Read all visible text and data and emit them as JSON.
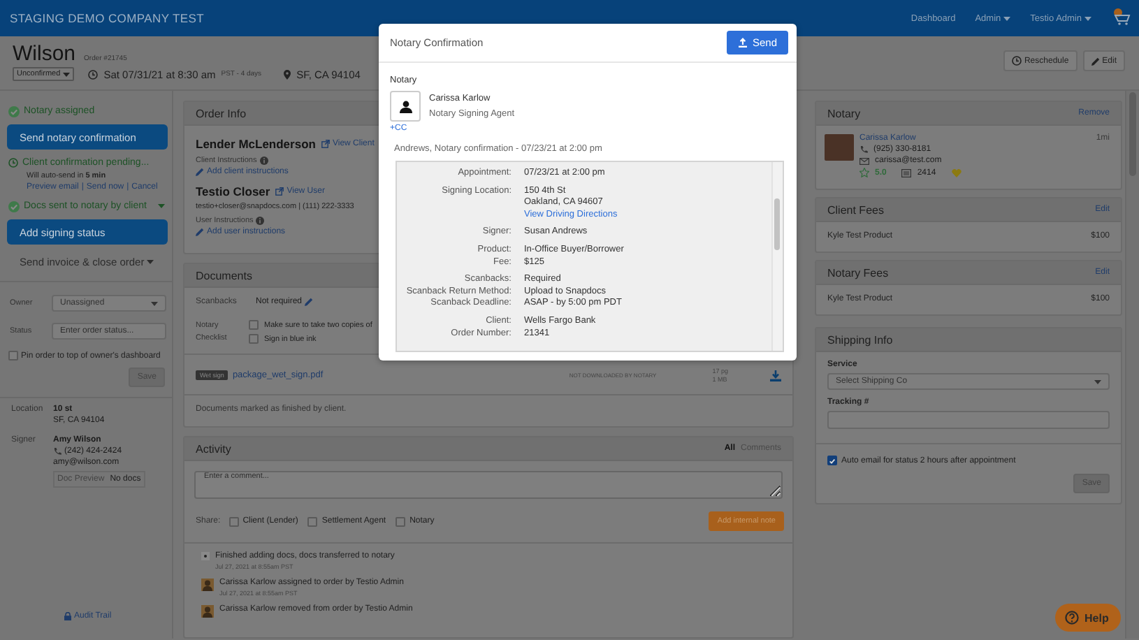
{
  "header": {
    "brand": "STAGING DEMO COMPANY TEST",
    "nav": [
      {
        "label": "Dashboard",
        "dropdown": false
      },
      {
        "label": "Admin",
        "dropdown": true
      },
      {
        "label": "Testio Admin",
        "dropdown": true
      }
    ]
  },
  "order": {
    "name": "Wilson",
    "number": "Order #21745",
    "status": "Unconfirmed",
    "datetime": "Sat 07/31/21 at 8:30 am",
    "timezone": "PST - 4 days",
    "location": "SF, CA 94104",
    "actions": [
      {
        "kind": "reschedule",
        "label": "Reschedule"
      },
      {
        "kind": "edit",
        "label": "Edit"
      }
    ]
  },
  "sidebar": {
    "steps": [
      {
        "kind": "done",
        "text": "Notary assigned",
        "dropdown": false
      },
      {
        "kind": "button",
        "text": "Send notary confirmation"
      },
      {
        "kind": "pending",
        "text": "Client confirmation pending...",
        "note": "Will auto-send in **5 min**",
        "links": [
          "Preview email",
          "Send now",
          "Cancel"
        ],
        "separator": "|"
      },
      {
        "kind": "done",
        "text": "Docs sent to notary by client",
        "dropdown": true
      },
      {
        "kind": "button",
        "text": "Add signing status"
      },
      {
        "kind": "menu",
        "text": "Send invoice & close order"
      }
    ],
    "owner": {
      "label": "Owner",
      "value": "Unassigned"
    },
    "status": {
      "label": "Status",
      "placeholder": "Enter order status..."
    },
    "pin": {
      "label": "Pin order to top of owner's dashboard",
      "checked": false
    },
    "save": "Save",
    "location": {
      "label": "Location",
      "lines": [
        "10 st",
        "SF, CA 94104"
      ]
    },
    "signer": {
      "label": "Signer",
      "name": "Amy Wilson",
      "phone": "(242) 424-2424",
      "email": "amy@wilson.com",
      "doc_preview": "Doc Preview",
      "docs": "No docs"
    },
    "audit_trail": "Audit Trail"
  },
  "order_info": {
    "title": "Order Info",
    "contacts": [
      {
        "name": "Lender McLenderson",
        "link": "View Client",
        "instructions": "Client Instructions",
        "add": "Add client instructions"
      },
      {
        "name": "Testio Closer",
        "link": "View User",
        "detail": "testio+closer@snapdocs.com | (111) 222-3333",
        "instructions": "User Instructions",
        "add": "Add user instructions"
      }
    ]
  },
  "documents": {
    "title": "Documents",
    "scanbacks": {
      "label": "Scanbacks",
      "value": "Not required"
    },
    "checklist": {
      "label": "Notary Checklist",
      "items": [
        {
          "text": "Make sure to take two copies of",
          "checked": false
        },
        {
          "text": "Sign in blue ink",
          "checked": false
        }
      ]
    },
    "files": [
      {
        "badge": "Wet sign",
        "name": "package_wet_sign.pdf",
        "status": "NOT DOWNLOADED BY NOTARY",
        "pages": "17 pg",
        "size": "1 MB"
      }
    ],
    "note": "Documents marked as finished by client."
  },
  "activity": {
    "title": "Activity",
    "filters": [
      {
        "label": "All",
        "selected": true
      },
      {
        "label": "Comments",
        "selected": false
      }
    ],
    "comment_placeholder": "Enter a comment...",
    "share_label": "Share:",
    "share_options": [
      {
        "label": "Client (Lender)",
        "checked": false
      },
      {
        "label": "Settlement Agent",
        "checked": false
      },
      {
        "label": "Notary",
        "checked": false
      }
    ],
    "add_button": "Add internal note",
    "events": [
      {
        "kind": "system",
        "text": "Finished adding docs, docs transferred to notary",
        "time": "Jul 27, 2021 at 8:55am PST"
      },
      {
        "kind": "user",
        "text": "Carissa Karlow assigned to order by Testio Admin",
        "time": "Jul 27, 2021 at 8:55am PST"
      },
      {
        "kind": "user",
        "text": "Carissa Karlow removed from order by Testio Admin"
      }
    ]
  },
  "notary": {
    "title": "Notary",
    "action": "Remove",
    "name": "Carissa Karlow",
    "phone": "(925) 330-8181",
    "email": "carissa@test.com",
    "rating": "5.0",
    "jobs": "2414",
    "distance": "1mi"
  },
  "fees": [
    {
      "title": "Client Fees",
      "action": "Edit",
      "items": [
        {
          "name": "Kyle Test Product",
          "amount": "$100"
        }
      ]
    },
    {
      "title": "Notary Fees",
      "action": "Edit",
      "items": [
        {
          "name": "Kyle Test Product",
          "amount": "$100"
        }
      ]
    }
  ],
  "shipping": {
    "title": "Shipping Info",
    "service_label": "Service",
    "service_value": "Select Shipping Co",
    "tracking_label": "Tracking #",
    "auto_email": {
      "label": "Auto email for status 2 hours after appointment",
      "checked": true
    },
    "save": "Save"
  },
  "help": "Help",
  "modal": {
    "title": "Notary Confirmation",
    "send": "Send",
    "section": "Notary",
    "recipient": {
      "name": "Carissa Karlow",
      "role": "Notary Signing Agent"
    },
    "cc": "+CC",
    "subject": "Andrews, Notary confirmation - 07/23/21 at 2:00 pm",
    "groups": [
      [
        {
          "label": "Appointment:",
          "lines": [
            "07/23/21 at 2:00 pm"
          ]
        }
      ],
      [
        {
          "label": "Signing Location:",
          "lines": [
            "150 4th St",
            "Oakland, CA 94607"
          ],
          "link": "View Driving Directions"
        }
      ],
      [
        {
          "label": "Signer:",
          "lines": [
            "Susan Andrews"
          ]
        }
      ],
      [
        {
          "label": "Product:",
          "lines": [
            "In-Office Buyer/Borrower"
          ]
        },
        {
          "label": "Fee:",
          "lines": [
            "$125"
          ]
        }
      ],
      [
        {
          "label": "Scanbacks:",
          "lines": [
            "Required"
          ]
        },
        {
          "label": "Scanback Return Method:",
          "lines": [
            "Upload to Snapdocs"
          ]
        },
        {
          "label": "Scanback Deadline:",
          "lines": [
            "ASAP - by 5:00 pm PDT"
          ]
        }
      ],
      [
        {
          "label": "Client:",
          "lines": [
            "Wells Fargo Bank"
          ]
        },
        {
          "label": "Order Number:",
          "lines": [
            "21341"
          ]
        }
      ]
    ]
  }
}
